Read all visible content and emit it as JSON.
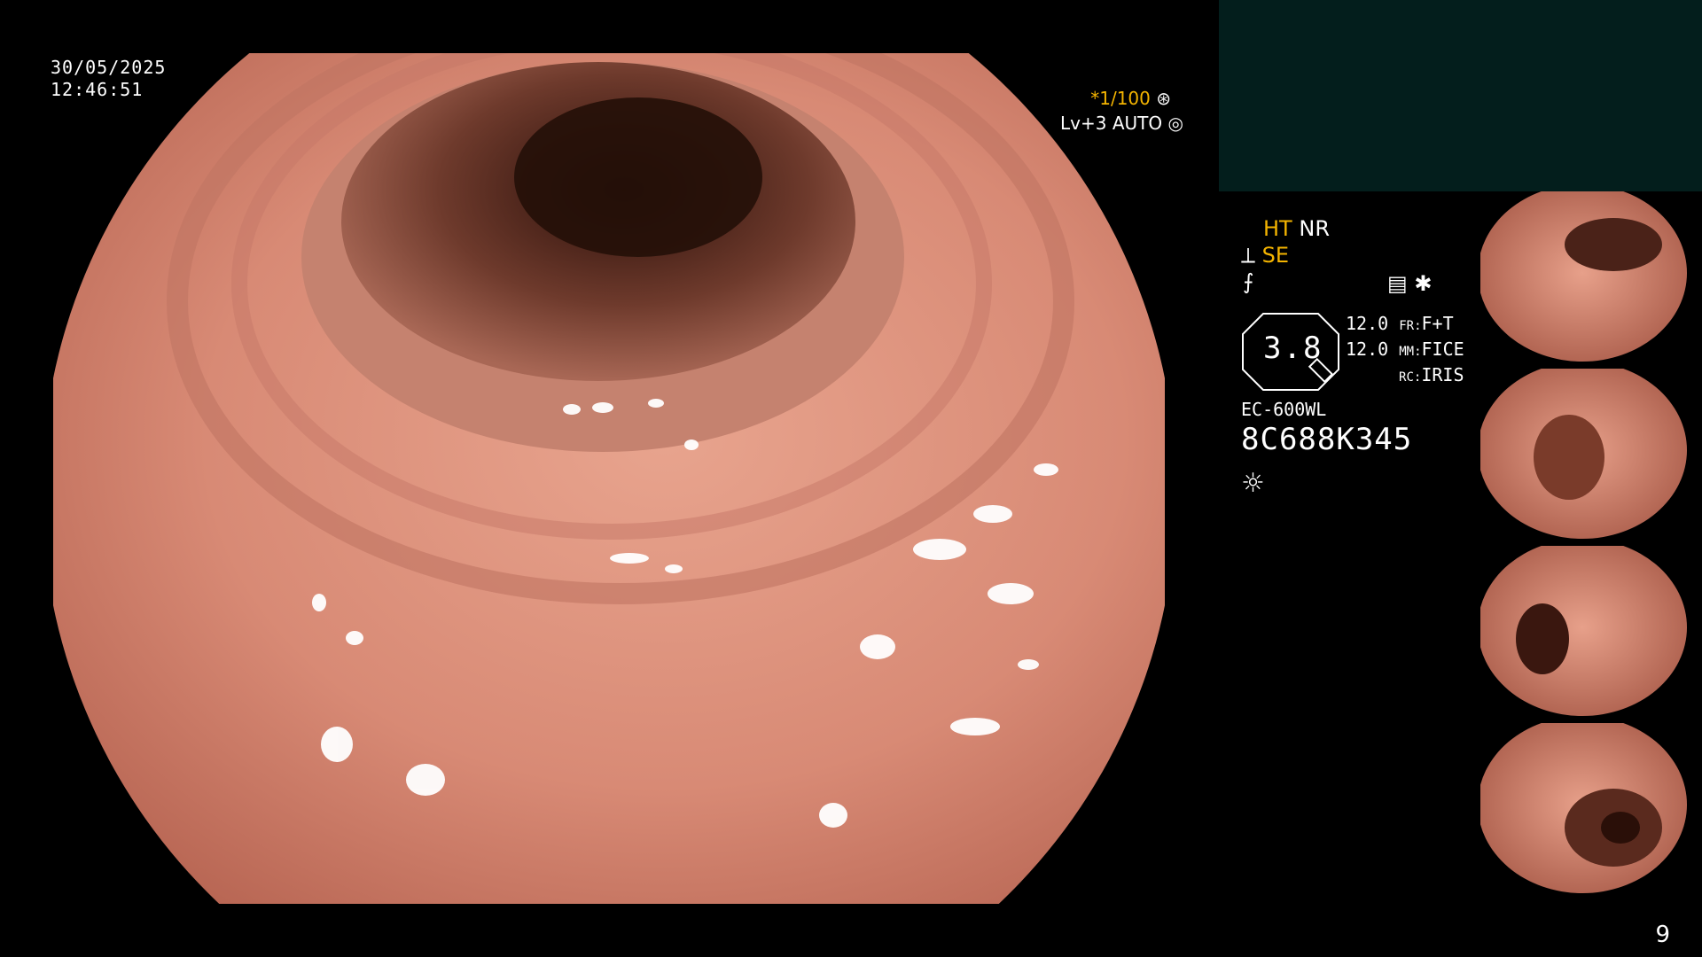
{
  "overlay": {
    "date": "30/05/2025",
    "time": "12:46:51",
    "shutter": "*1/100",
    "level": "Lv+3 AUTO"
  },
  "panel": {
    "ht": "HT",
    "nr": "NR",
    "se": "SE",
    "gauge_value": "3.8",
    "specs": [
      {
        "value": "12.0",
        "label": "FR:",
        "mode": "F+T"
      },
      {
        "value": "12.0",
        "label": "MM:",
        "mode": "FICE"
      },
      {
        "value": "",
        "label": "RC:",
        "mode": "IRIS"
      }
    ],
    "scope_model": "EC-600WL",
    "scope_serial": "8C688K345"
  },
  "page_number": "9",
  "colors": {
    "status_bg": "#031e1c",
    "accent_yellow": "#f4b400",
    "mucosa": "#d98a76",
    "lumen": "#3a1a12"
  },
  "icons": [
    "aperture-icon",
    "settings-icon",
    "scope-icon",
    "zoom-icon",
    "menu-icon",
    "star-icon",
    "light-icon"
  ]
}
